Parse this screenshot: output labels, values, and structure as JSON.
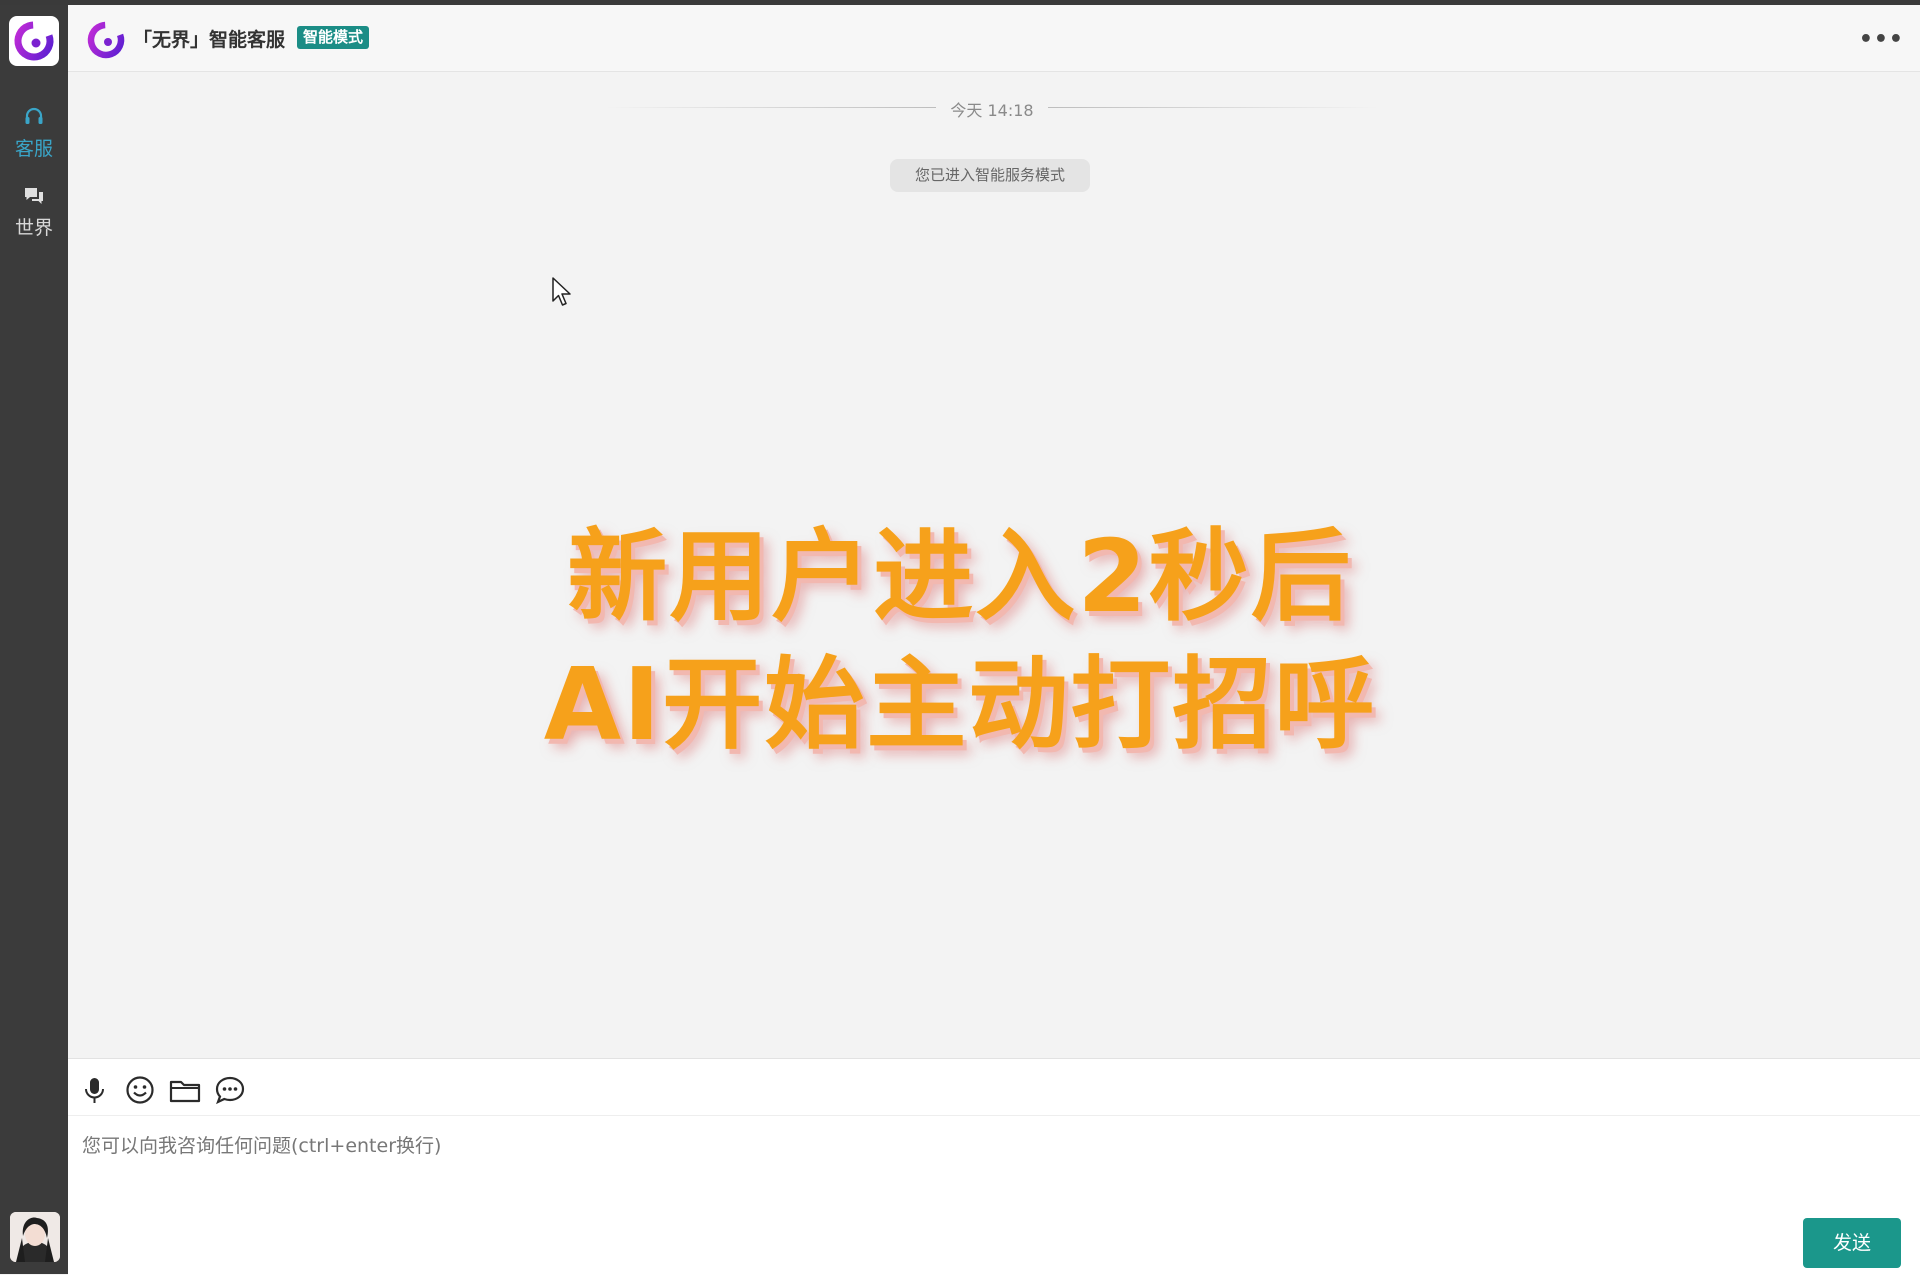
{
  "header": {
    "title": "「无界」智能客服",
    "mode_badge": "智能模式",
    "more_label": "•••"
  },
  "sidebar": {
    "items": [
      {
        "label": "客服",
        "icon": "headset-icon",
        "active": true
      },
      {
        "label": "世界",
        "icon": "chat-bubbles-icon",
        "active": false
      }
    ]
  },
  "chat": {
    "timestamp": "今天 14:18",
    "system_message": "您已进入智能服务模式"
  },
  "overlay": {
    "line1": "新用户进入2秒后",
    "line2": "AI开始主动打招呼"
  },
  "composer": {
    "placeholder": "您可以向我咨询任何问题(ctrl+enter换行)",
    "value": "",
    "tools": [
      "microphone-icon",
      "emoji-icon",
      "folder-icon",
      "chat-dots-icon"
    ],
    "send_label": "发送"
  },
  "colors": {
    "accent": "#1b8d86",
    "rail_bg": "#3b3b3b",
    "active_tab": "#3aa5c8",
    "overlay_text": "#f6a11b"
  }
}
